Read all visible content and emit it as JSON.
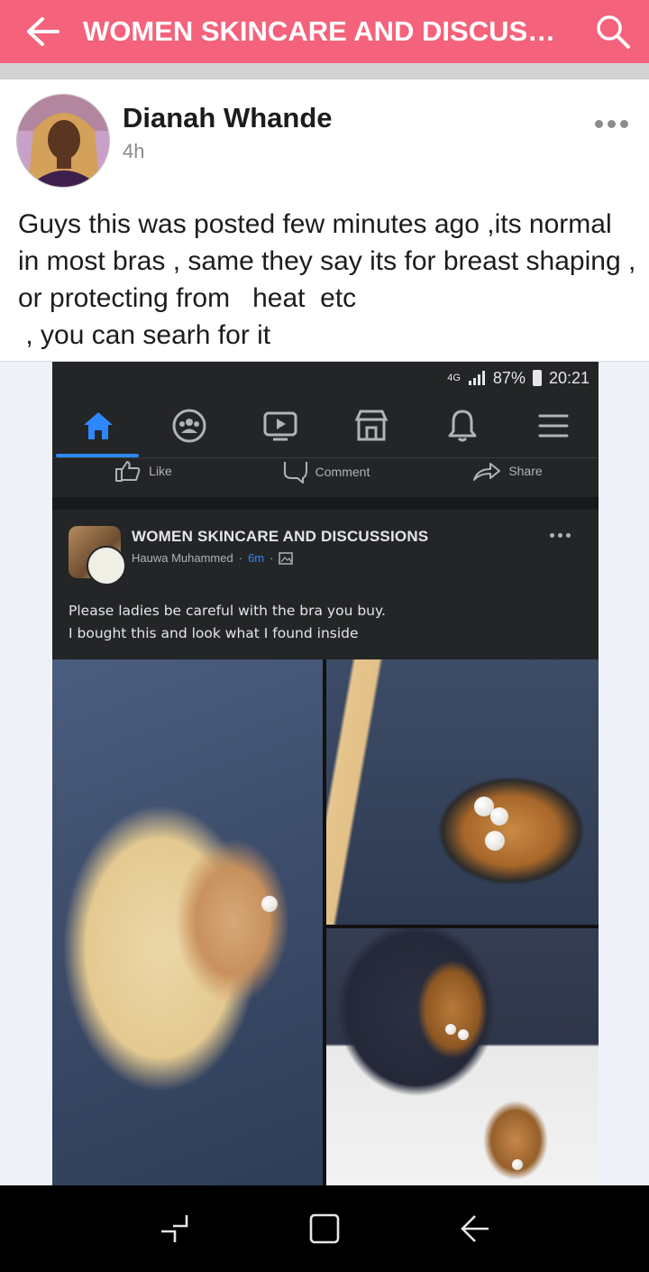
{
  "appbar": {
    "title": "WOMEN SKINCARE AND DISCUSSIONS",
    "bg_color": "#f4627b",
    "back_icon": "arrow-left-icon",
    "search_icon": "search-icon"
  },
  "post": {
    "author": "Dianah Whande",
    "time": "4h",
    "text": "Guys this was posted few minutes ago ,its normal in most bras , same they say its for breast shaping , or protecting from   heat  etc\n , you can searh for it"
  },
  "embedded_screenshot": {
    "status": {
      "network": "4G",
      "battery": "87%",
      "time": "20:21"
    },
    "nav_icons": [
      "home-icon",
      "groups-icon",
      "watch-icon",
      "marketplace-icon",
      "bell-icon",
      "menu-icon"
    ],
    "actions": {
      "like": "Like",
      "comment": "Comment",
      "share": "Share"
    },
    "group_name": "WOMEN SKINCARE AND DISCUSSIONS",
    "poster": "Hauwa Muhammed",
    "ago": "6m",
    "text": "Please ladies be careful with the bra you buy.\nI bought this and look what I found inside"
  },
  "system_nav": [
    "recents-icon",
    "home-square-icon",
    "back-icon"
  ]
}
